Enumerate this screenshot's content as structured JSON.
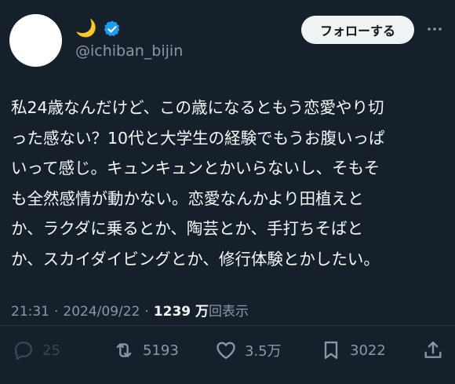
{
  "author": {
    "display_name": "🌙",
    "handle": "@ichiban_bijin",
    "verified": true
  },
  "follow_button_label": "フォローする",
  "more_icon": "more-icon",
  "tweet_text": "私24歳なんだけど、この歳になるともう恋愛やり切\nった感ない？10代と大学生の経験でもうお腹いっぱ\nいって感じ。キュンキュンとかいらないし、そもそ\nも全然感情が動かない。恋愛なんかより田植えと\nか、ラクダに乗るとか、陶芸とか、手打ちそばと\nか、スカイダイビングとか、修行体験とかしたい。",
  "meta": {
    "time": "21:31",
    "sep1": "·",
    "date": "2024/09/22",
    "sep2": "·",
    "views_count": "1239 万",
    "views_label": "回表示"
  },
  "actions": {
    "replies": "25",
    "retweets": "5193",
    "likes": "3.5万",
    "bookmarks": "3022"
  },
  "colors": {
    "background": "#15202b",
    "text": "#f7f9f9",
    "secondary": "#8b98a5",
    "verified": "#1d9bf0",
    "follow_bg": "#eff3f4"
  }
}
